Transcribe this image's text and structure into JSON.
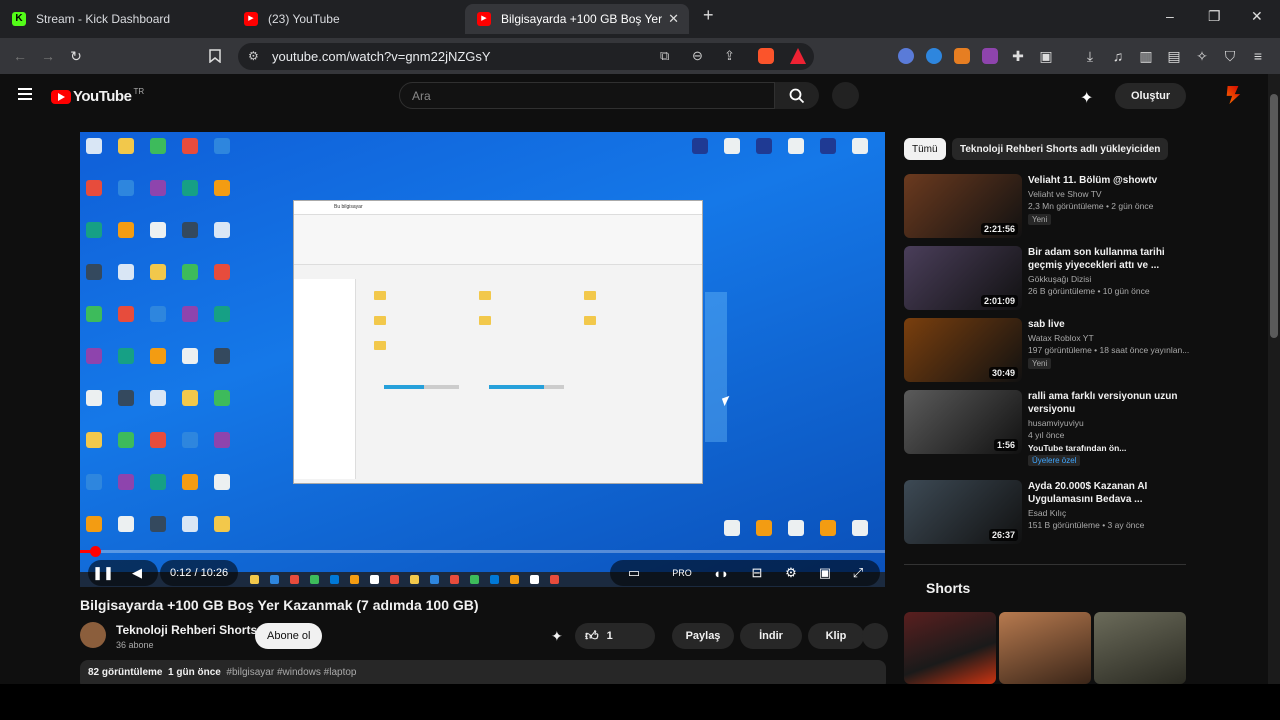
{
  "browser": {
    "tabs": [
      {
        "label": "Stream - Kick Dashboard",
        "color": "#53fc18",
        "glyph": "K"
      },
      {
        "label": "(23) YouTube",
        "color": "#ff0000",
        "glyph": "▶"
      },
      {
        "label": "Bilgisayarda +100 GB Boş Yer",
        "color": "#ff0000",
        "glyph": "▶"
      }
    ],
    "new_tab": "+",
    "url": "youtube.com/watch?v=gnm22jNZGsY",
    "window_controls": {
      "minimize": "–",
      "restore": "❐",
      "close": "✕"
    }
  },
  "yt": {
    "logo_text": "YouTube",
    "logo_country": "TR",
    "search_placeholder": "Ara",
    "create_label": "Oluştur"
  },
  "player": {
    "time": "0:12 / 10:26",
    "progress_fraction": 0.019,
    "explorer_title": "Bu bilgisayar"
  },
  "video": {
    "title": "Bilgisayarda +100 GB Boş Yer Kazanmak (7 adımda 100 GB)",
    "channel": "Teknoloji Rehberi Shorts",
    "subscribers": "36 abone",
    "subscribe_label": "Abone ol",
    "likes": "1",
    "share_label": "Paylaş",
    "download_label": "İndir",
    "clip_label": "Klip",
    "views": "82 görüntüleme",
    "age": "1 gün önce",
    "tags": "#bilgisayar #windows #laptop"
  },
  "sidebar": {
    "chips": [
      "Tümü",
      "Teknoloji Rehberi Shorts adlı yükleyiciden"
    ],
    "recommendations": [
      {
        "title": "Veliaht 11. Bölüm @showtv",
        "channel": "Veliaht   ve Show TV",
        "meta": "2,3 Mn görüntüleme • 2 gün önce",
        "badge": "Yeni",
        "duration": "2:21:56",
        "thumb_color": "#6b3a1f"
      },
      {
        "title": "Bir adam son kullanma tarihi geçmiş yiyecekleri attı ve ...",
        "channel": "Gökkuşağı Dizisi",
        "meta": "26 B görüntüleme • 10 gün önce",
        "badge": "",
        "duration": "2:01:09",
        "thumb_color": "#4a3e5a"
      },
      {
        "title": "sab live",
        "channel": "Watax Roblox YT",
        "meta": "197 görüntüleme • 18 saat önce yayınlan...",
        "badge": "Yeni",
        "duration": "30:49",
        "thumb_color": "#7a3f0e"
      },
      {
        "title": "ralli ama farklı versiyonun uzun versiyonu",
        "channel": "husamviyuviyu",
        "meta": "4 yıl önce",
        "badge": "",
        "extra1": "YouTube tarafından ön...",
        "extra2": "Üyelere özel",
        "duration": "1:56",
        "thumb_color": "#5b5b5b"
      },
      {
        "title": "Ayda 20.000$ Kazanan AI Uygulamasını Bedava ...",
        "channel": "Esad Kılıç",
        "meta": "151 B görüntüleme • 3 ay önce",
        "badge": "",
        "duration": "26:37",
        "thumb_color": "#3d4a55"
      }
    ],
    "shorts_title": "Shorts"
  }
}
